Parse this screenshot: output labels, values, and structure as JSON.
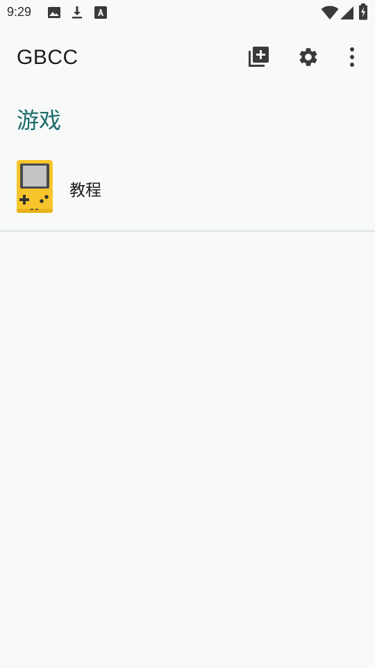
{
  "status_bar": {
    "time": "9:29",
    "icons_left": [
      "image-icon",
      "download-icon",
      "text-icon"
    ],
    "icons_right": [
      "wifi-icon",
      "signal-icon",
      "battery-charging-icon"
    ]
  },
  "app_bar": {
    "title": "GBCC",
    "actions": [
      "add-library-icon",
      "settings-icon",
      "more-vert-icon"
    ]
  },
  "section": {
    "title": "游戏"
  },
  "games": [
    {
      "label": "教程",
      "icon": "gameboy-color-icon",
      "icon_color": "#f7c52b"
    }
  ],
  "colors": {
    "background": "#f8fafa",
    "accent": "#1d6b6b",
    "text": "#1b1b1b",
    "divider": "#dcdfdf"
  }
}
